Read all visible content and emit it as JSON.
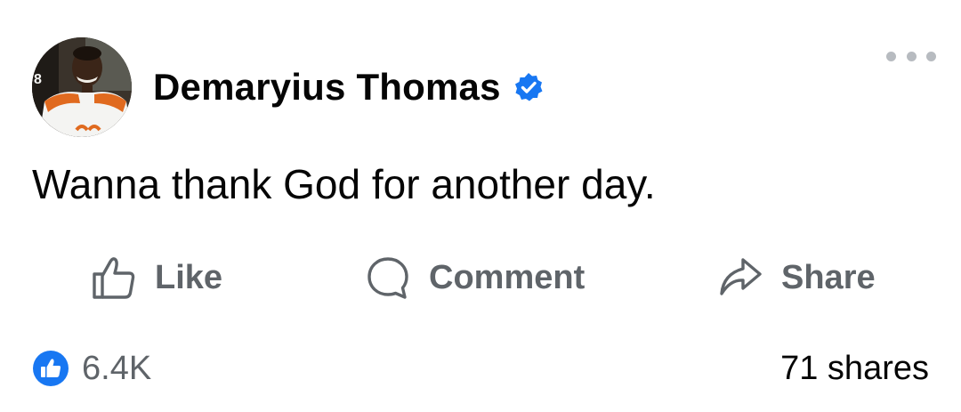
{
  "post": {
    "author": "Demaryius Thomas",
    "text": "Wanna thank God for another day.",
    "verified": true
  },
  "actions": {
    "like_label": "Like",
    "comment_label": "Comment",
    "share_label": "Share"
  },
  "stats": {
    "reactions_count": "6.4K",
    "shares_count": "71 shares"
  },
  "icons": {
    "verified": "verified-badge-icon",
    "more": "more-options-icon",
    "like": "thumbs-up-icon",
    "comment": "speech-bubble-icon",
    "share": "share-arrow-icon",
    "reaction": "like-reaction-icon"
  },
  "colors": {
    "accent_blue": "#1877F2",
    "text_primary": "#050505",
    "text_secondary": "#65676B",
    "more_dots": "#B7BBC0"
  }
}
